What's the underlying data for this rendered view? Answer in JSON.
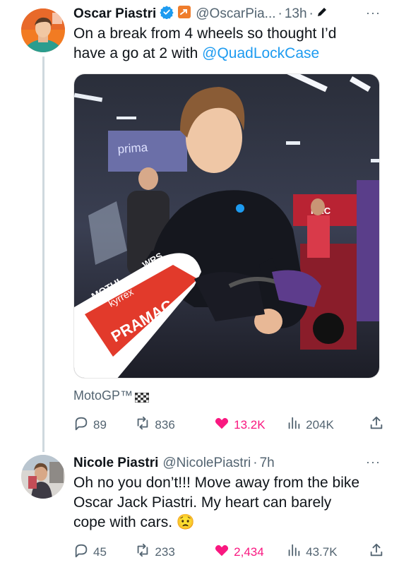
{
  "tweet1": {
    "name": "Oscar Piastri",
    "handle": "@OscarPia...",
    "separator": "·",
    "time": "13h",
    "time_suffix": "·",
    "text_line1": "On a break from 4 wheels so thought I’d",
    "text_line2": "have a go at 2 with ",
    "mention": "@QuadLockCase",
    "photo_text": {
      "banner": "prima",
      "fairing_1": "MOTUL",
      "fairing_2": "WRS",
      "fairing_3": "kyrrex",
      "fairing_4": "PRAMAC",
      "bg_sign": "RAC"
    },
    "tag": "MotoGP™",
    "stats": {
      "replies": "89",
      "retweets": "836",
      "likes": "13.2K",
      "views": "204K"
    }
  },
  "tweet2": {
    "name": "Nicole Piastri",
    "handle": "@NicolePiastri",
    "separator": "·",
    "time": "7h",
    "text_line1": "Oh no you don’t!!! Move away from the bike",
    "text_line2": "Oscar Jack Piastri. My heart can barely",
    "text_line3": "cope with cars. ",
    "emoji": "😟",
    "stats": {
      "replies": "45",
      "retweets": "233",
      "likes": "2,434",
      "views": "43.7K"
    }
  },
  "colors": {
    "accent": "#1d9bf0",
    "like": "#f91880",
    "muted": "#536471",
    "verified_badge": "#1d9bf0",
    "affiliate_badge": "#ef7d2c"
  },
  "icons": {
    "more": "more-dots-icon",
    "reply": "reply-icon",
    "retweet": "retweet-icon",
    "like": "heart-icon",
    "views": "views-icon",
    "share": "share-icon"
  },
  "more_label": "···"
}
